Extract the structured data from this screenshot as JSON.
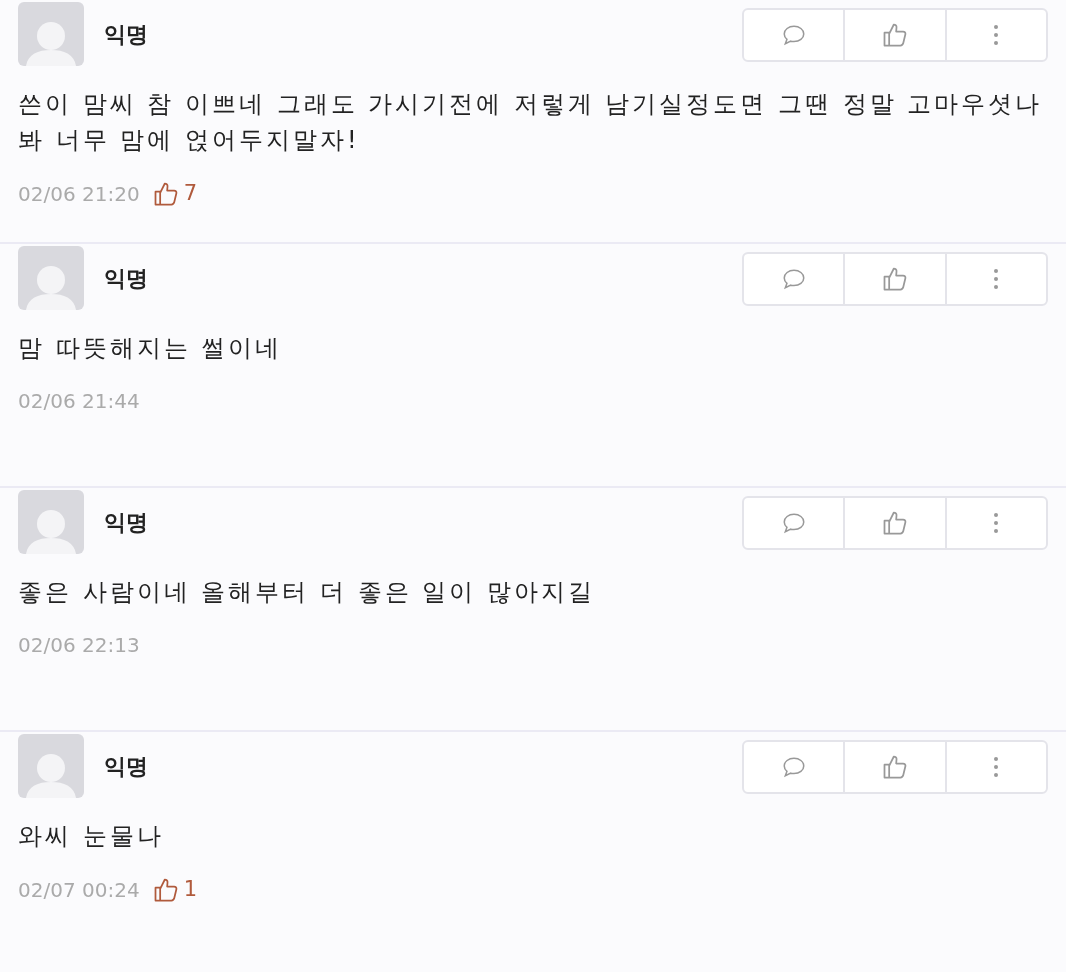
{
  "comments": [
    {
      "author": "익명",
      "text": "쓴이 맘씨 참 이쁘네 그래도 가시기전에 저렇게 남기실정도면 그땐 정말 고마우셧나 봐 너무 맘에 얹어두지말자!",
      "time": "02/06 21:20",
      "likes": "7"
    },
    {
      "author": "익명",
      "text": "맘 따뜻해지는 썰이네",
      "time": "02/06 21:44"
    },
    {
      "author": "익명",
      "text": "좋은 사람이네 올해부터 더 좋은 일이 많아지길",
      "time": "02/06 22:13"
    },
    {
      "author": "익명",
      "text": "와씨 눈물나",
      "time": "02/07 00:24",
      "likes": "1"
    }
  ]
}
